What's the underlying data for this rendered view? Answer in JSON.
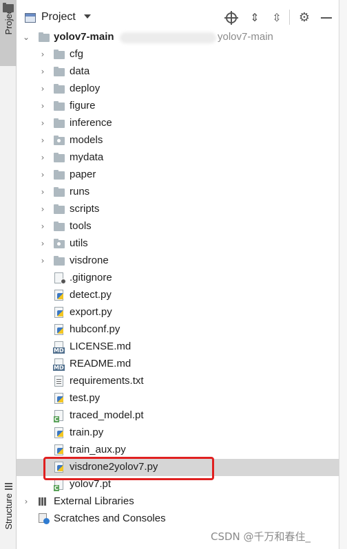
{
  "left_stripe": {
    "project_label": "Project",
    "structure_label": "Structure"
  },
  "header": {
    "title": "Project"
  },
  "root": {
    "name": "yolov7-main",
    "path": "yolov7-main"
  },
  "folders": [
    {
      "name": "cfg",
      "module": false
    },
    {
      "name": "data",
      "module": false
    },
    {
      "name": "deploy",
      "module": false
    },
    {
      "name": "figure",
      "module": false
    },
    {
      "name": "inference",
      "module": false
    },
    {
      "name": "models",
      "module": true
    },
    {
      "name": "mydata",
      "module": false
    },
    {
      "name": "paper",
      "module": false
    },
    {
      "name": "runs",
      "module": false
    },
    {
      "name": "scripts",
      "module": false
    },
    {
      "name": "tools",
      "module": false
    },
    {
      "name": "utils",
      "module": true
    },
    {
      "name": "visdrone",
      "module": false
    }
  ],
  "files": [
    {
      "name": ".gitignore",
      "icon": "gitignore-file-icon"
    },
    {
      "name": "detect.py",
      "icon": "python-file-icon"
    },
    {
      "name": "export.py",
      "icon": "python-file-icon"
    },
    {
      "name": "hubconf.py",
      "icon": "python-file-icon"
    },
    {
      "name": "LICENSE.md",
      "icon": "markdown-file-icon"
    },
    {
      "name": "README.md",
      "icon": "markdown-file-icon"
    },
    {
      "name": "requirements.txt",
      "icon": "text-file-icon"
    },
    {
      "name": "test.py",
      "icon": "python-file-icon"
    },
    {
      "name": "traced_model.pt",
      "icon": "pt-file-icon"
    },
    {
      "name": "train.py",
      "icon": "python-file-icon"
    },
    {
      "name": "train_aux.py",
      "icon": "python-file-icon"
    },
    {
      "name": "visdrone2yolov7.py",
      "icon": "python-file-icon",
      "selected": true
    },
    {
      "name": "yolov7.pt",
      "icon": "pt-file-icon"
    }
  ],
  "external_libraries": "External Libraries",
  "scratches": "Scratches and Consoles",
  "badges": {
    "md": "MD",
    "c": "C"
  },
  "watermark": "CSDN @千万和春住_",
  "colors": {
    "selection": "#d6d6d6",
    "highlight_border": "#e02020",
    "folder": "#aeb9c0"
  }
}
